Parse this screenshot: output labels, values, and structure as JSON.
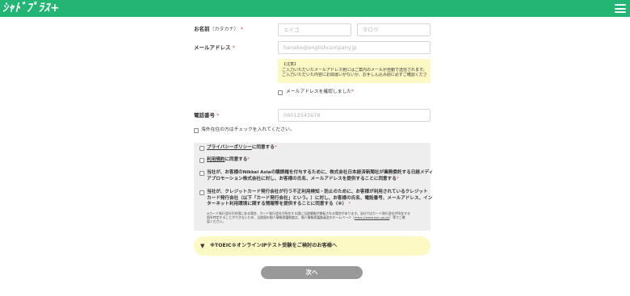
{
  "header": {
    "logo_text": "ｼｬﾄﾞﾌﾟﾗｽ+",
    "menu_icon": "hamburger-icon",
    "bg_color": "#22b573"
  },
  "form": {
    "name": {
      "label": "お名前",
      "label_sub": "（カタカナ）",
      "required_mark": "*",
      "last_placeholder": "エイゴ",
      "first_placeholder": "タロウ"
    },
    "email": {
      "label": "メールアドレス",
      "required_mark": "*",
      "placeholder": "hanako@englishcompany.jp"
    },
    "notice": {
      "title": "【注意】",
      "line1": "ご入力いただいたメールアドレス宛にはご案内のメールが自動で送信されます。",
      "line2": "ご入力いただいた内容にお間違いがないか、お手しん込み前に必ずご確認ください。"
    },
    "email_confirm": {
      "label": "メールアドレスを確認しました",
      "required_mark": "*"
    },
    "phone": {
      "label": "電話番号",
      "required_mark": "*",
      "placeholder": "09012345678"
    },
    "overseas": {
      "label": "海外在住の方はチェックを入れてください。"
    }
  },
  "agreements": {
    "privacy": {
      "link": "プライバシーポリシー",
      "rest": "に同意する",
      "required_mark": "*"
    },
    "terms": {
      "link": "利用規約",
      "rest": "に同意する",
      "required_mark": "*"
    },
    "nikkei": {
      "line1": "当社が、お客様のNikkei Asiaの購読権を付与するために、株式会社日本経済新聞社が業務委託する日経メディ",
      "line2": "アプロモーション株式会社に対し、お客様の氏名、メールアドレスを提供することに同意する",
      "required_mark": "*"
    },
    "card": {
      "line1": "当社が、クレジットカード発行会社が行う不正利用検知・防止のために、お客様が利用されているクレジット",
      "line2": "カード発行会社（以下「カード発行会社」という。）に対し、お客様の氏名、電話番号、メールアドレス、イン",
      "line3": "ターネット利用環境に関する情報等を提供することに同意する（※）",
      "required_mark": "*",
      "note1": "※カード発行会社が外国にある場合、カード発行会社が所在する国に当該情報が移転される場合があります。当社ではカード発行会社が所在する",
      "note2": "国を特定することができないため、当該国の個人情報保護制度は、個人情報保護委員会のホームページ（",
      "note_link": "https://www.ppc.go.jp/",
      "note3": "）等でご確",
      "note4": "認ください。"
    }
  },
  "toeic": {
    "arrow": "▼",
    "label": "※TOEIC®オンラインIPテスト受験をご検討のお客様へ"
  },
  "next_button": {
    "label": "次へ"
  },
  "colors": {
    "accent": "#22b573",
    "notice_bg": "#fdf9c4",
    "required": "#e5484d",
    "disabled_button": "#999999"
  }
}
